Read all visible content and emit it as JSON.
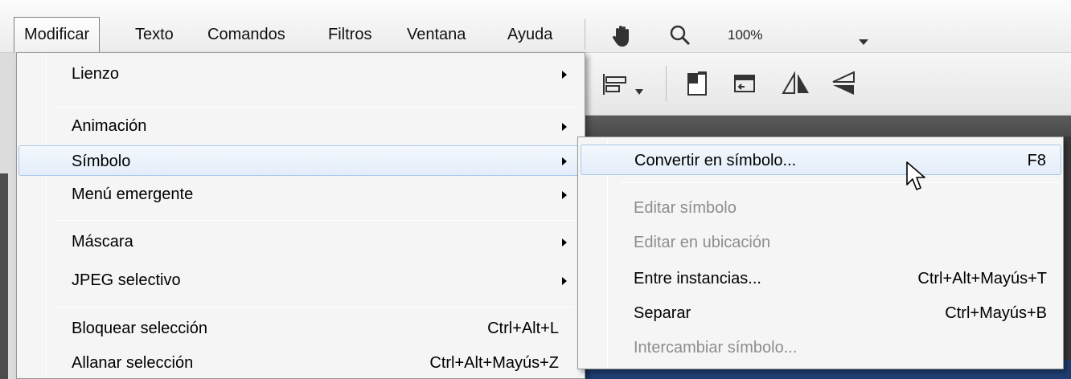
{
  "menubar": {
    "items": [
      {
        "label": "Modificar",
        "active": true
      },
      {
        "label": "Texto"
      },
      {
        "label": "Comandos"
      },
      {
        "label": "Filtros"
      },
      {
        "label": "Ventana"
      },
      {
        "label": "Ayuda"
      }
    ],
    "zoom": "100%",
    "icons": [
      "hand-icon",
      "zoom-icon",
      "chevron-down-icon"
    ]
  },
  "toolbar": {
    "icons": [
      "align-icon",
      "dropdown-icon",
      "rotate-icon",
      "distort-icon",
      "flip-horizontal-icon",
      "flip-vertical-icon"
    ]
  },
  "modificar_menu": {
    "items": [
      {
        "label": "Lienzo",
        "submenu": true
      },
      {
        "label": "Animación",
        "submenu": true
      },
      {
        "label": "Símbolo",
        "submenu": true
      },
      {
        "label": "Menú emergente",
        "submenu": true
      },
      {
        "label": "Máscara",
        "submenu": true
      },
      {
        "label": "JPEG selectivo",
        "submenu": true
      },
      {
        "label": "Bloquear selección",
        "shortcut": "Ctrl+Alt+L"
      },
      {
        "label": "Allanar selección",
        "shortcut": "Ctrl+Alt+Mayús+Z"
      }
    ]
  },
  "simbolo_submenu": {
    "items": [
      {
        "label": "Convertir en símbolo...",
        "shortcut": "F8"
      },
      {
        "label": "Editar símbolo",
        "disabled": true
      },
      {
        "label": "Editar en ubicación",
        "disabled": true
      },
      {
        "label": "Entre instancias...",
        "shortcut": "Ctrl+Alt+Mayús+T"
      },
      {
        "label": "Separar",
        "shortcut": "Ctrl+Mayús+B"
      },
      {
        "label": "Intercambiar símbolo...",
        "disabled": true
      }
    ]
  },
  "colors": {
    "hover_border": "#a9c8ea",
    "stage": "#1f3f73",
    "disabled_text": "#8d8d8d"
  }
}
